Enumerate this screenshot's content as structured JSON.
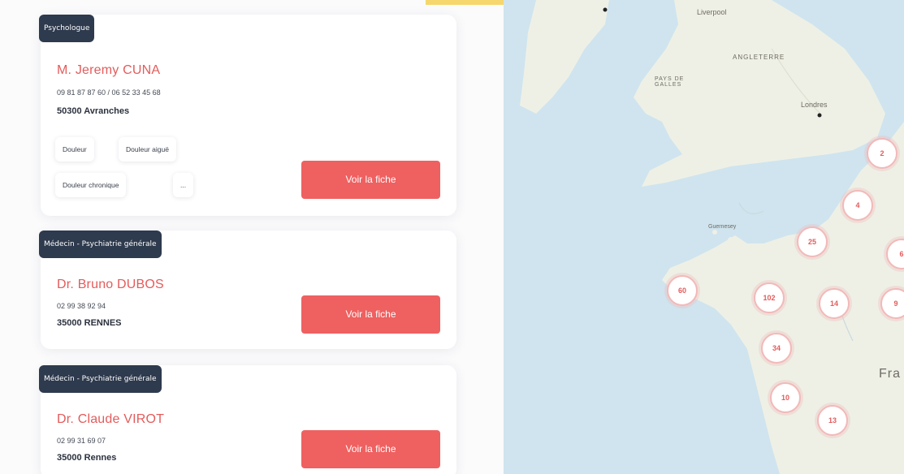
{
  "results": [
    {
      "category": "Psychologue",
      "name": "M. Jeremy CUNA",
      "phones": "09 81 87 87 60 / 06 52 33 45 68",
      "city": "50300 Avranches",
      "tags": [
        "Douleur",
        "Douleur aiguë",
        "Douleur chronique",
        "..."
      ],
      "button": "Voir la fiche"
    },
    {
      "category": "Médecin - Psychiatrie générale",
      "name": "Dr. Bruno DUBOS",
      "phones": "02 99 38 92 94",
      "city": "35000 RENNES",
      "button": "Voir la fiche"
    },
    {
      "category": "Médecin - Psychiatrie générale",
      "name": "Dr. Claude VIROT",
      "phones": "02 99 31 69 07",
      "city": "35000 Rennes",
      "button": "Voir la fiche"
    }
  ],
  "map": {
    "labels": {
      "liverpool": "Liverpool",
      "angleterre": "ANGLETERRE",
      "pays_de_galles": "PAYS DE\nGALLES",
      "londres": "Londres",
      "guernsey": "Guernesey",
      "france": "Fra"
    },
    "clusters": [
      "2",
      "4",
      "25",
      "6",
      "60",
      "102",
      "14",
      "9",
      "34",
      "10",
      "13"
    ],
    "colors": {
      "sea": "#cfe4ee",
      "land": "#eef0e6",
      "cluster_text": "#e45b5b"
    }
  }
}
